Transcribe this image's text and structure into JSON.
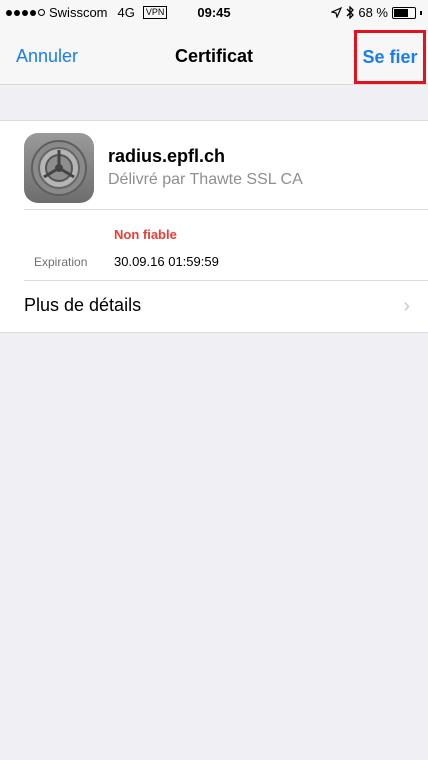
{
  "status_bar": {
    "carrier": "Swisscom",
    "network": "4G",
    "vpn": "VPN",
    "time": "09:45",
    "battery": "68 %",
    "battery_level": 0.68,
    "signal_bars_filled": 4,
    "signal_bars_total": 5
  },
  "nav": {
    "cancel_label": "Annuler",
    "title": "Certificat",
    "trust_label": "Se fier"
  },
  "certificate": {
    "name": "radius.epfl.ch",
    "issuer": "Délivré par Thawte SSL CA",
    "status": "Non fiable",
    "expiration_label": "Expiration",
    "expiration_value": "30.09.16 01:59:59",
    "details_label": "Plus de détails",
    "icon": "settings-gear-icon"
  },
  "colors": {
    "accent": "#1a7cf5",
    "danger": "#f23a2f",
    "highlight": "#e0141e",
    "background": "#efeff4"
  }
}
